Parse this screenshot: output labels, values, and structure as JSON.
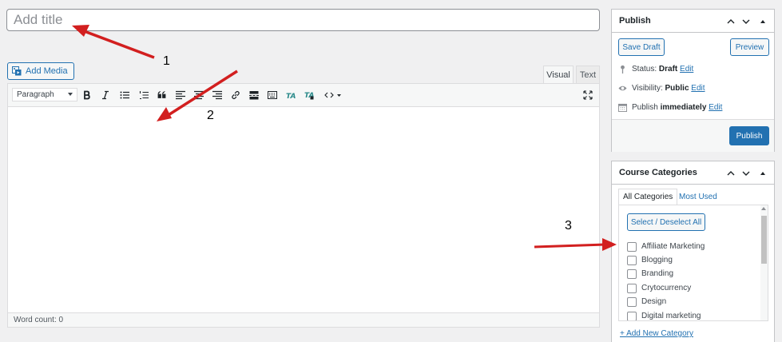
{
  "title": {
    "placeholder": "Add title"
  },
  "editor": {
    "add_media_label": "Add Media",
    "tabs": [
      "Visual",
      "Text"
    ],
    "format_select": "Paragraph",
    "toolbar_buttons": [
      "bold",
      "italic",
      "bulleted-list",
      "numbered-list",
      "blockquote",
      "align-left",
      "align-center",
      "align-right",
      "insert-link",
      "read-more",
      "toolbar-toggle",
      "ta-text",
      "ta-toggle",
      "code"
    ],
    "word_count": "Word count: 0"
  },
  "publish": {
    "heading": "Publish",
    "save_draft_label": "Save Draft",
    "preview_label": "Preview",
    "status_label": "Status:",
    "status_value": "Draft",
    "visibility_label": "Visibility:",
    "visibility_value": "Public",
    "schedule_label": "Publish",
    "schedule_value": "immediately",
    "edit_label": "Edit",
    "publish_label": "Publish"
  },
  "categories": {
    "heading": "Course Categories",
    "tabs": [
      "All Categories",
      "Most Used"
    ],
    "select_all_label": "Select / Deselect All",
    "items": [
      "Affiliate Marketing",
      "Blogging",
      "Branding",
      "Crytocurrency",
      "Design",
      "Digital marketing"
    ],
    "add_new_label": "+ Add New Category"
  },
  "annotations": {
    "labels": [
      "1",
      "2",
      "3"
    ],
    "color": "#d21f1f"
  },
  "colors": {
    "accent": "#2271b1",
    "background": "#f0f0f1"
  }
}
